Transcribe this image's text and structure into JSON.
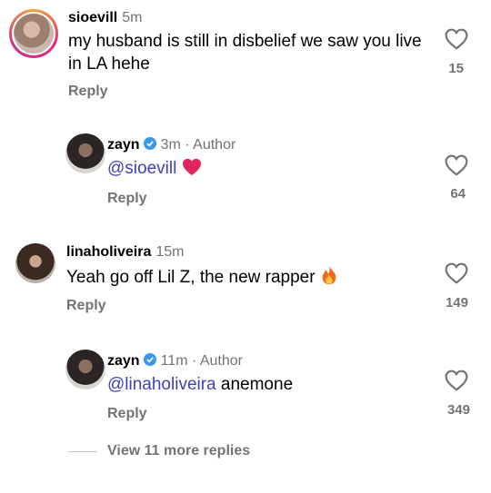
{
  "comments": [
    {
      "username": "sioevill",
      "time": "5m",
      "text": "my husband is still in disbelief we saw you live in LA hehe",
      "reply_label": "Reply",
      "likes": "15"
    },
    {
      "username": "zayn",
      "time": "3m",
      "author_label": "· Author",
      "mention": "@sioevill",
      "reply_label": "Reply",
      "likes": "64"
    },
    {
      "username": "linaholiveira",
      "time": "15m",
      "text": "Yeah go off Lil Z, the new rapper",
      "reply_label": "Reply",
      "likes": "149"
    },
    {
      "username": "zayn",
      "time": "11m",
      "author_label": "· Author",
      "mention": "@linaholiveira",
      "text": "anemone",
      "reply_label": "Reply",
      "likes": "349"
    }
  ],
  "view_more": "View 11 more replies",
  "colors": {
    "mention": "#3d3fb5",
    "secondary": "#737373",
    "verified": "#3897f0",
    "heart_red": "#e0245e"
  },
  "icons": [
    "heart-outline-icon",
    "verified-badge-icon",
    "red-heart-emoji",
    "fire-emoji"
  ]
}
